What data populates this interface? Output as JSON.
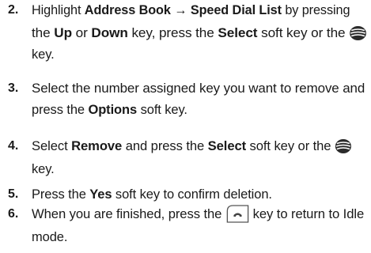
{
  "steps": [
    {
      "number": "2.",
      "lines": [
        [
          {
            "t": "Highlight "
          },
          {
            "t": "Address Book",
            "b": true
          },
          {
            "t": " "
          },
          {
            "t": "→",
            "b": true
          },
          {
            "t": " "
          },
          {
            "t": "Speed Dial List",
            "b": true
          },
          {
            "t": " by pressing"
          }
        ],
        [
          {
            "t": "the "
          },
          {
            "t": "Up",
            "b": true
          },
          {
            "t": " or "
          },
          {
            "t": "Down",
            "b": true
          },
          {
            "t": " key, press the "
          },
          {
            "t": "Select",
            "b": true
          },
          {
            "t": " soft key or the "
          },
          {
            "icon": "navigation-key"
          }
        ],
        [
          {
            "t": "key."
          }
        ]
      ]
    },
    {
      "number": "3.",
      "lines": [
        [
          {
            "t": "Select the number assigned key you want to remove and"
          }
        ],
        [
          {
            "t": "press the "
          },
          {
            "t": "Options",
            "b": true
          },
          {
            "t": " soft key."
          }
        ]
      ]
    },
    {
      "number": "4.",
      "lines": [
        [
          {
            "t": "Select "
          },
          {
            "t": "Remove",
            "b": true
          },
          {
            "t": " and press the "
          },
          {
            "t": "Select",
            "b": true
          },
          {
            "t": " soft key or the "
          },
          {
            "icon": "navigation-key"
          }
        ],
        [
          {
            "t": "key."
          }
        ]
      ]
    },
    {
      "number": "5.",
      "lines": [
        [
          {
            "t": "Press the "
          },
          {
            "t": "Yes",
            "b": true
          },
          {
            "t": " soft key to confirm deletion."
          }
        ]
      ]
    },
    {
      "number": "6.",
      "lines": [
        [
          {
            "t": "When you are finished, press the "
          },
          {
            "icon": "end-key"
          },
          {
            "t": " key to return to Idle"
          }
        ],
        [
          {
            "t": "mode."
          }
        ]
      ]
    }
  ]
}
